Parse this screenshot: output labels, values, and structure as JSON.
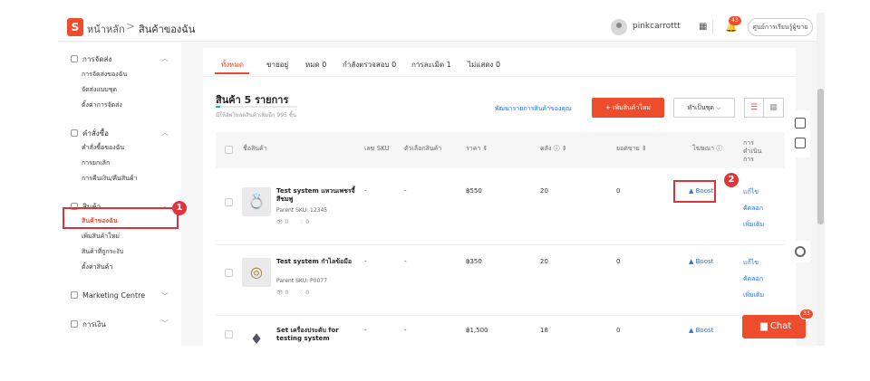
{
  "header": {
    "logo": "S",
    "home": "หน้าหลัก",
    "separator": ">",
    "current": "สินค้าของฉัน",
    "username": "pinkcarrottt",
    "notif_count": "43",
    "help_btn": "ศูนย์การเรียนรู้ผู้ขาย"
  },
  "sidebar": {
    "sections": [
      {
        "title": "การจัดส่ง",
        "items": [
          "การจัดส่งของฉัน",
          "จัดส่งแบบชุด",
          "ตั้งค่าการจัดส่ง"
        ]
      },
      {
        "title": "คำสั่งซื้อ",
        "items": [
          "คำสั่งซื้อของฉัน",
          "การยกเลิก",
          "การคืนเงิน/คืนสินค้า"
        ]
      },
      {
        "title": "สินค้า",
        "items": [
          "สินค้าของฉัน",
          "เพิ่มสินค้าใหม่",
          "สินค้าที่ถูกระงับ",
          "ตั้งค่าสินค้า"
        ]
      },
      {
        "title": "Marketing Centre",
        "items": []
      },
      {
        "title": "การเงิน",
        "items": []
      }
    ],
    "active_item": "สินค้าของฉัน",
    "marker": "1"
  },
  "tabs": [
    {
      "label": "ทั้งหมด",
      "active": true
    },
    {
      "label": "ขายอยู่",
      "active": false
    },
    {
      "label": "หมด 0",
      "active": false
    },
    {
      "label": "กำลังตรวจสอบ 0",
      "active": false
    },
    {
      "label": "การละเมิด 1",
      "active": false
    },
    {
      "label": "ไม่แสดง 0",
      "active": false
    }
  ],
  "summary": {
    "count": "สินค้า 5 รายการ",
    "quota": "มีให้อัพโหลดสินค้าเพิ่มอีก 995 ชิ้น",
    "quota_fraction": 0.05,
    "improve": "พัฒนารายการสินค้าของคุณ",
    "add": "+ เพิ่มสินค้าใหม่",
    "batch": "ทำเป็นชุด",
    "chevron": "⌵"
  },
  "columns": {
    "name": "ชื่อสินค้า",
    "sku": "เลข SKU",
    "variation": "ตัวเลือกสินค้า",
    "price": "ราคา ⇕",
    "stock": "คลัง ⓘ ⇕",
    "sales": "ยอดขาย ⇕",
    "ads": "โฆษณา ⓘ",
    "actions": "การดำเนินการ"
  },
  "rows": [
    {
      "name": "Test system แหวนเพชรจี้สีชมพู",
      "parent_sku": "Parent SKU: 12345",
      "views": "👁 0",
      "likes": "♡ 0",
      "sku": "-",
      "variation": "-",
      "price": "฿550",
      "stock": "20",
      "sales": "0",
      "boost": "Boost",
      "edit": "แก้ไข",
      "copy": "คัดลอก",
      "more": "เพิ่มเติม",
      "thumb": "💍"
    },
    {
      "name": "Test system กำไลข้อมือ",
      "parent_sku": "Parent SKU: P0077",
      "views": "👁 0",
      "likes": "♡ 0",
      "sku": "-",
      "variation": "-",
      "price": "฿350",
      "stock": "20",
      "sales": "0",
      "boost": "Boost",
      "edit": "แก้ไข",
      "copy": "คัดลอก",
      "more": "เพิ่มเติม",
      "thumb": "◎"
    },
    {
      "name": "Set เครื่องประดับ for testing system",
      "parent_sku": "",
      "views": "",
      "likes": "",
      "sku": "-",
      "variation": "-",
      "price": "฿1,500",
      "stock": "18",
      "sales": "0",
      "boost": "Boost",
      "edit": "",
      "copy": "",
      "more": "",
      "thumb": "♦"
    }
  ],
  "edit_marker": "2",
  "chat": {
    "label": "Chat",
    "badge": "33"
  },
  "colors": {
    "brand": "#ee4d2d",
    "link": "#2673dd",
    "annotation": "#d9343a"
  }
}
